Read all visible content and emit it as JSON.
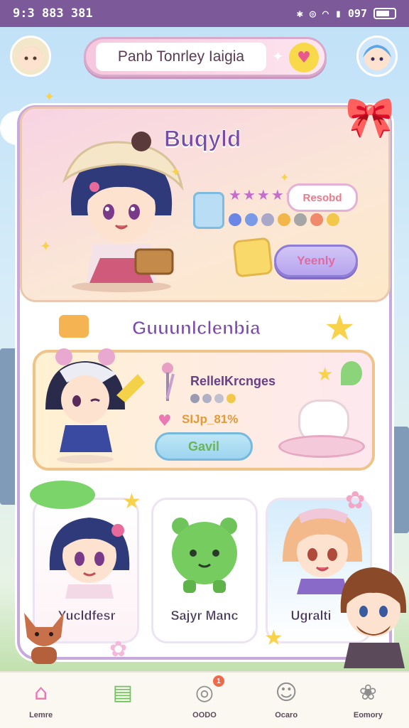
{
  "status_bar": {
    "time": "9:3 883 381",
    "battery_text": "097"
  },
  "header": {
    "search_text": "Panb Tonrley Iaigia"
  },
  "hero": {
    "title": "Buqyld",
    "review_label": "Resobd",
    "button_label": "Yeenly"
  },
  "section": {
    "title": "Guuunlclenbia"
  },
  "featured": {
    "title": "RelleIKrcnges",
    "price": "SIJp_81%",
    "button_label": "Gavil"
  },
  "tiles": [
    {
      "label": "Yucldfesr"
    },
    {
      "label": "Sajyr Manc"
    },
    {
      "label": "Ugralti"
    }
  ],
  "nav": {
    "badge_count": "1",
    "items": [
      {
        "label": "Lemre",
        "icon": "home-icon"
      },
      {
        "label": "",
        "icon": "book-icon"
      },
      {
        "label": "OODO",
        "icon": "ring-icon"
      },
      {
        "label": "Ocaro",
        "icon": "person-icon"
      },
      {
        "label": "Eomory",
        "icon": "group-icon"
      }
    ]
  },
  "colors": {
    "accent": "#7a4aa8",
    "status_bar": "#7c5a9a",
    "nav_active": "#e97ab4"
  }
}
